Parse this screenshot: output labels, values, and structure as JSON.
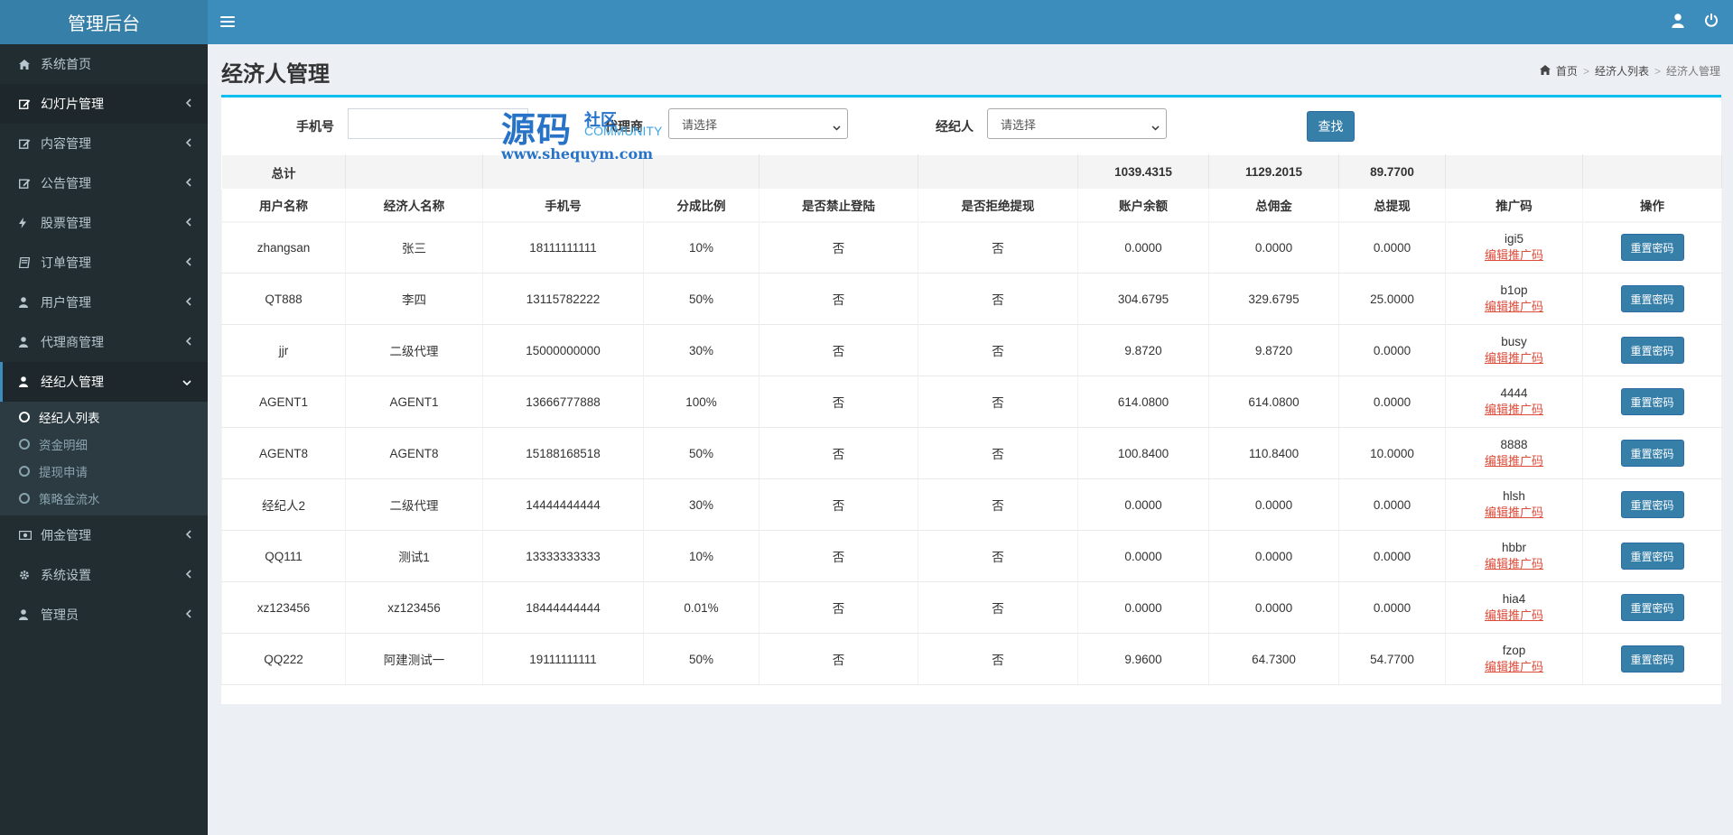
{
  "sidebar": {
    "brand": "管理后台",
    "items": [
      {
        "label": "系统首页",
        "icon": "home-icon"
      },
      {
        "label": "幻灯片管理",
        "icon": "edit-icon"
      },
      {
        "label": "内容管理",
        "icon": "edit-icon"
      },
      {
        "label": "公告管理",
        "icon": "edit-icon"
      },
      {
        "label": "股票管理",
        "icon": "bolt-icon"
      },
      {
        "label": "订单管理",
        "icon": "book-icon"
      },
      {
        "label": "用户管理",
        "icon": "user-icon"
      },
      {
        "label": "代理商管理",
        "icon": "user-icon"
      },
      {
        "label": "经纪人管理",
        "icon": "user-icon"
      },
      {
        "label": "佣金管理",
        "icon": "money-icon"
      },
      {
        "label": "系统设置",
        "icon": "gear-icon"
      },
      {
        "label": "管理员",
        "icon": "user-icon"
      }
    ],
    "submenu": [
      "经纪人列表",
      "资金明细",
      "提现申请",
      "策略金流水"
    ]
  },
  "header": {
    "page_title": "经济人管理",
    "breadcrumb": [
      "首页",
      "经济人列表",
      "经济人管理"
    ]
  },
  "filter": {
    "phone_label": "手机号",
    "phone_value": "",
    "agent_label": "代理商",
    "agent_selected": "请选择",
    "broker_label": "经纪人",
    "broker_selected": "请选择",
    "search_button": "查找"
  },
  "watermark": {
    "main": "源码",
    "sub1": "社区",
    "sub2": "COMMUNITY",
    "url": "www.shequym.com"
  },
  "table": {
    "total_label": "总计",
    "total_balance": "1039.4315",
    "total_commission": "1129.2015",
    "total_withdraw": "89.7700",
    "columns": [
      "用户名称",
      "经济人名称",
      "手机号",
      "分成比例",
      "是否禁止登陆",
      "是否拒绝提现",
      "账户余额",
      "总佣金",
      "总提现",
      "推广码",
      "操作"
    ],
    "edit_link_label": "编辑推广码",
    "reset_button_label": "重置密码",
    "rows": [
      {
        "username": "zhangsan",
        "broker": "张三",
        "phone": "18111111111",
        "ratio": "10%",
        "ban_login": "否",
        "deny_withdraw": "否",
        "balance": "0.0000",
        "commission": "0.0000",
        "withdraw": "0.0000",
        "code": "igi5"
      },
      {
        "username": "QT888",
        "broker": "李四",
        "phone": "13115782222",
        "ratio": "50%",
        "ban_login": "否",
        "deny_withdraw": "否",
        "balance": "304.6795",
        "commission": "329.6795",
        "withdraw": "25.0000",
        "code": "b1op"
      },
      {
        "username": "jjr",
        "broker": "二级代理",
        "phone": "15000000000",
        "ratio": "30%",
        "ban_login": "否",
        "deny_withdraw": "否",
        "balance": "9.8720",
        "commission": "9.8720",
        "withdraw": "0.0000",
        "code": "busy"
      },
      {
        "username": "AGENT1",
        "broker": "AGENT1",
        "phone": "13666777888",
        "ratio": "100%",
        "ban_login": "否",
        "deny_withdraw": "否",
        "balance": "614.0800",
        "commission": "614.0800",
        "withdraw": "0.0000",
        "code": "4444"
      },
      {
        "username": "AGENT8",
        "broker": "AGENT8",
        "phone": "15188168518",
        "ratio": "50%",
        "ban_login": "否",
        "deny_withdraw": "否",
        "balance": "100.8400",
        "commission": "110.8400",
        "withdraw": "10.0000",
        "code": "8888"
      },
      {
        "username": "经纪人2",
        "broker": "二级代理",
        "phone": "14444444444",
        "ratio": "30%",
        "ban_login": "否",
        "deny_withdraw": "否",
        "balance": "0.0000",
        "commission": "0.0000",
        "withdraw": "0.0000",
        "code": "hlsh"
      },
      {
        "username": "QQ111",
        "broker": "测试1",
        "phone": "13333333333",
        "ratio": "10%",
        "ban_login": "否",
        "deny_withdraw": "否",
        "balance": "0.0000",
        "commission": "0.0000",
        "withdraw": "0.0000",
        "code": "hbbr"
      },
      {
        "username": "xz123456",
        "broker": "xz123456",
        "phone": "18444444444",
        "ratio": "0.01%",
        "ban_login": "否",
        "deny_withdraw": "否",
        "balance": "0.0000",
        "commission": "0.0000",
        "withdraw": "0.0000",
        "code": "hia4"
      },
      {
        "username": "QQ222",
        "broker": "阿建测试一",
        "phone": "19111111111",
        "ratio": "50%",
        "ban_login": "否",
        "deny_withdraw": "否",
        "balance": "9.9600",
        "commission": "64.7300",
        "withdraw": "54.7700",
        "code": "fzop"
      }
    ]
  }
}
